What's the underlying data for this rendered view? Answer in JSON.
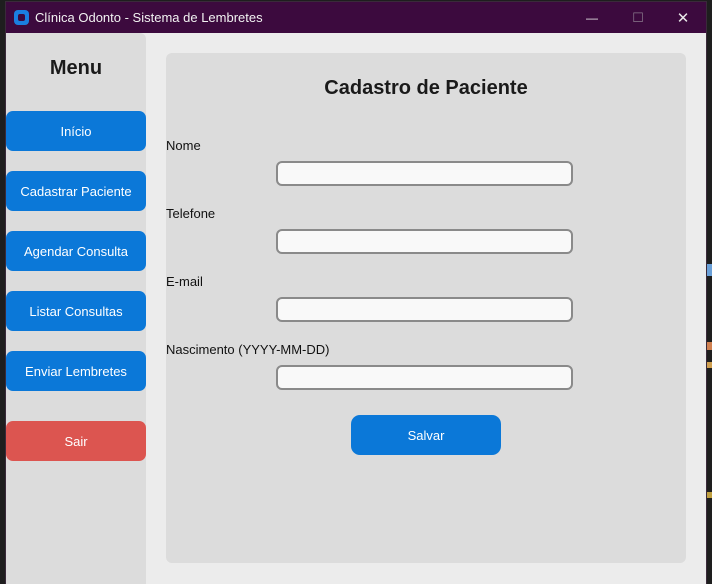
{
  "window": {
    "title": "Clínica Odonto - Sistema de Lembretes",
    "icon": "app-icon",
    "controls": {
      "minimize": "—",
      "maximize": "☐",
      "close": "✕"
    }
  },
  "sidebar": {
    "title": "Menu",
    "items": [
      {
        "label": "Início"
      },
      {
        "label": "Cadastrar Paciente"
      },
      {
        "label": "Agendar Consulta"
      },
      {
        "label": "Listar Consultas"
      },
      {
        "label": "Enviar Lembretes"
      }
    ],
    "exit_label": "Sair"
  },
  "form": {
    "title": "Cadastro de Paciente",
    "fields": [
      {
        "label": "Nome",
        "value": ""
      },
      {
        "label": "Telefone",
        "value": ""
      },
      {
        "label": "E-mail",
        "value": ""
      },
      {
        "label": "Nascimento (YYYY-MM-DD)",
        "value": ""
      }
    ],
    "save_label": "Salvar"
  },
  "colors": {
    "titlebar": "#3c0a3e",
    "primary_button": "#0b78d8",
    "exit_button": "#dc5550",
    "panel": "#dcdcdc",
    "window_bg": "#ececec"
  }
}
